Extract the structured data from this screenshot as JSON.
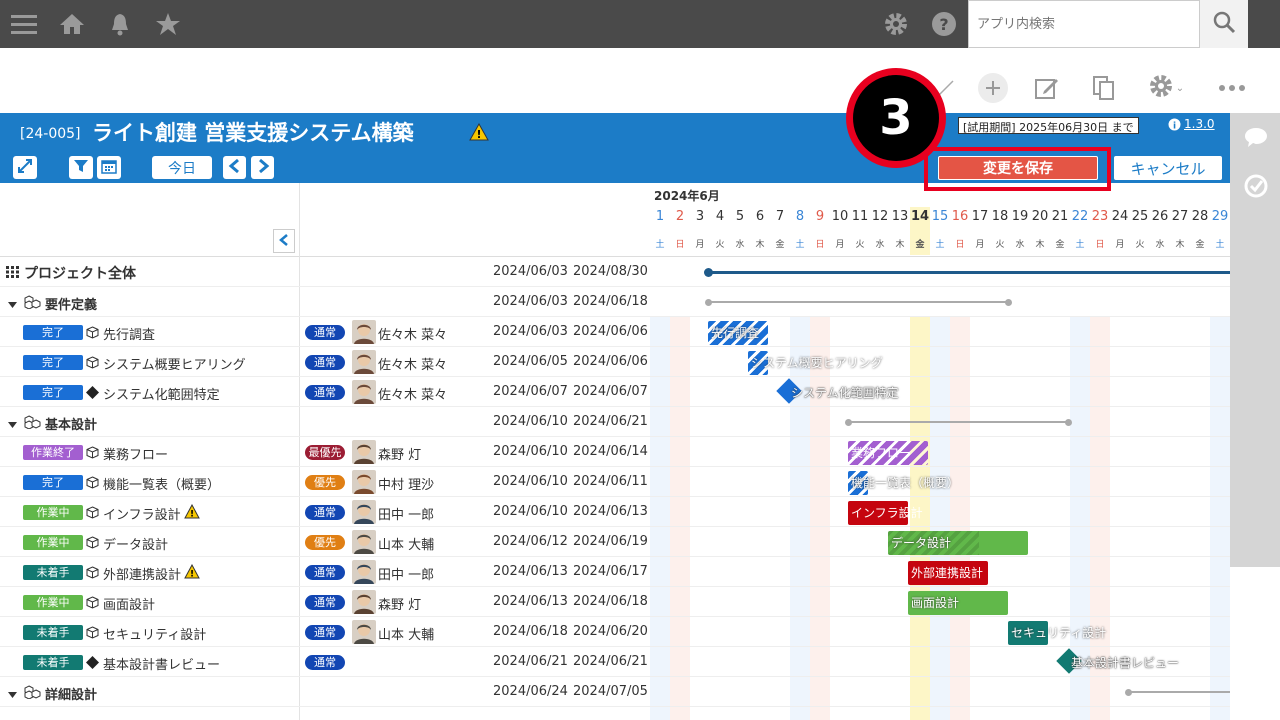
{
  "topbar": {
    "search_placeholder": "アプリ内検索"
  },
  "header": {
    "code": "[24-005]",
    "title": "ライト創建 営業支援システム構築",
    "trial": "[試用期間] 2025年06月30日 まで",
    "version": "1.3.0",
    "today_label": "今日",
    "save_label": "変更を保存",
    "cancel_label": "キャンセル"
  },
  "step_number": "3",
  "gantt": {
    "month": "2024年6月",
    "days": [
      {
        "d": "1",
        "w": "土"
      },
      {
        "d": "2",
        "w": "日"
      },
      {
        "d": "3",
        "w": "月"
      },
      {
        "d": "4",
        "w": "火"
      },
      {
        "d": "5",
        "w": "水"
      },
      {
        "d": "6",
        "w": "木"
      },
      {
        "d": "7",
        "w": "金"
      },
      {
        "d": "8",
        "w": "土"
      },
      {
        "d": "9",
        "w": "日"
      },
      {
        "d": "10",
        "w": "月"
      },
      {
        "d": "11",
        "w": "火"
      },
      {
        "d": "12",
        "w": "水"
      },
      {
        "d": "13",
        "w": "木"
      },
      {
        "d": "14",
        "w": "金"
      },
      {
        "d": "15",
        "w": "土"
      },
      {
        "d": "16",
        "w": "日"
      },
      {
        "d": "17",
        "w": "月"
      },
      {
        "d": "18",
        "w": "火"
      },
      {
        "d": "19",
        "w": "水"
      },
      {
        "d": "20",
        "w": "木"
      },
      {
        "d": "21",
        "w": "金"
      },
      {
        "d": "22",
        "w": "土"
      },
      {
        "d": "23",
        "w": "日"
      },
      {
        "d": "24",
        "w": "月"
      },
      {
        "d": "25",
        "w": "火"
      },
      {
        "d": "26",
        "w": "水"
      },
      {
        "d": "27",
        "w": "木"
      },
      {
        "d": "28",
        "w": "金"
      },
      {
        "d": "29",
        "w": "土"
      }
    ]
  },
  "rows": [
    {
      "type": "project",
      "name": "プロジェクト全体",
      "start": "2024/06/03",
      "end": "2024/08/30"
    },
    {
      "type": "group",
      "name": "要件定義",
      "start": "2024/06/03",
      "end": "2024/06/18"
    },
    {
      "type": "task",
      "status": "完了",
      "name": "先行調査",
      "prio": "通常",
      "person": "佐々木 菜々",
      "start": "2024/06/03",
      "end": "2024/06/06"
    },
    {
      "type": "task",
      "status": "完了",
      "name": "システム概要ヒアリング",
      "prio": "通常",
      "person": "佐々木 菜々",
      "start": "2024/06/05",
      "end": "2024/06/06"
    },
    {
      "type": "milestone",
      "status": "完了",
      "name": "システム化範囲特定",
      "prio": "通常",
      "person": "佐々木 菜々",
      "start": "2024/06/07",
      "end": "2024/06/07"
    },
    {
      "type": "group",
      "name": "基本設計",
      "start": "2024/06/10",
      "end": "2024/06/21"
    },
    {
      "type": "task",
      "status": "作業終了",
      "name": "業務フロー",
      "prio": "最優先",
      "person": "森野 灯",
      "start": "2024/06/10",
      "end": "2024/06/14"
    },
    {
      "type": "task",
      "status": "完了",
      "name": "機能一覧表（概要）",
      "prio": "優先",
      "person": "中村 理沙",
      "start": "2024/06/10",
      "end": "2024/06/11"
    },
    {
      "type": "task",
      "status": "作業中",
      "name": "インフラ設計",
      "prio": "通常",
      "person": "田中 一郎",
      "start": "2024/06/10",
      "end": "2024/06/13"
    },
    {
      "type": "task",
      "status": "作業中",
      "name": "データ設計",
      "prio": "優先",
      "person": "山本 大輔",
      "start": "2024/06/12",
      "end": "2024/06/19"
    },
    {
      "type": "task",
      "status": "未着手",
      "name": "外部連携設計",
      "prio": "通常",
      "person": "田中 一郎",
      "start": "2024/06/13",
      "end": "2024/06/17"
    },
    {
      "type": "task",
      "status": "作業中",
      "name": "画面設計",
      "prio": "通常",
      "person": "森野 灯",
      "start": "2024/06/13",
      "end": "2024/06/18"
    },
    {
      "type": "task",
      "status": "未着手",
      "name": "セキュリティ設計",
      "prio": "通常",
      "person": "山本 大輔",
      "start": "2024/06/18",
      "end": "2024/06/20"
    },
    {
      "type": "milestone",
      "status": "未着手",
      "name": "基本設計書レビュー",
      "prio": "通常",
      "person": "",
      "start": "2024/06/21",
      "end": "2024/06/21"
    },
    {
      "type": "group",
      "name": "詳細設計",
      "start": "2024/06/24",
      "end": "2024/07/05"
    }
  ],
  "bars": [
    {
      "label": "先行調査"
    },
    {
      "label": "システム概要ヒアリング"
    },
    {
      "label": "システム化範囲特定"
    },
    {
      "label": "業務フロー"
    },
    {
      "label": "機能一覧表（概要）"
    },
    {
      "label": "インフラ設計"
    },
    {
      "label": "データ設計"
    },
    {
      "label": "外部連携設計"
    },
    {
      "label": "画面設計"
    },
    {
      "label": "セキュリティ設計"
    },
    {
      "label": "基本設計書レビュー"
    }
  ],
  "colors": {
    "header": "#1c7cc7",
    "done": "#1a6fd6",
    "finished": "#a35fd0",
    "doing": "#61b84a",
    "todo": "#127a72",
    "save": "#e45545",
    "highlight": "#e8001f"
  }
}
